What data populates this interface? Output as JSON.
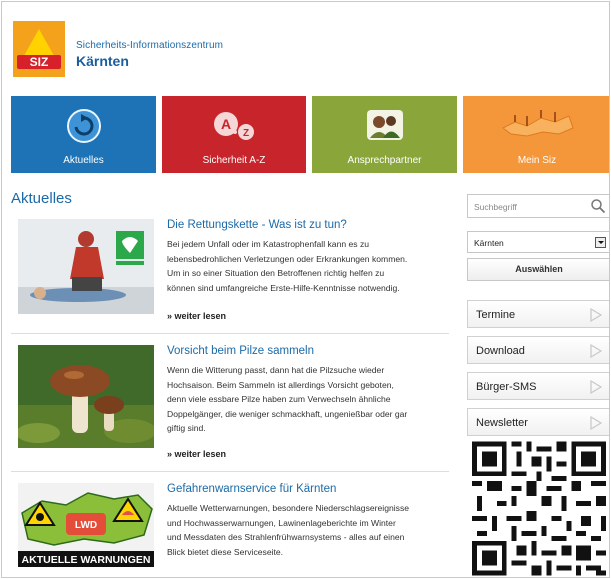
{
  "header": {
    "logo_text": "SIZ",
    "line1": "Sicherheits-Informationszentrum",
    "line2": "Kärnten"
  },
  "tiles": [
    {
      "label": "Aktuelles",
      "color": "#1d73b5",
      "icon": "refresh-arrow-icon"
    },
    {
      "label": "Sicherheit A-Z",
      "color": "#c8242b",
      "icon": "a-to-z-icon"
    },
    {
      "label": "Ansprechpartner",
      "color": "#8aa63a",
      "icon": "people-icon"
    },
    {
      "label": "Mein Siz",
      "color": "#f4973a",
      "icon": "map-icon"
    }
  ],
  "section_title": "Aktuelles",
  "articles": [
    {
      "title": "Die Rettungskette - Was ist zu tun?",
      "lines": [
        "Bei jedem Unfall oder im Katastrophenfall kann es zu",
        "lebensbedrohlichen Verletzungen oder Erkrankungen kommen.",
        "Um in so einer Situation den Betroffenen richtig helfen zu",
        "können sind umfangreiche Erste-Hilfe-Kenntnisse notwendig."
      ],
      "more": "» weiter lesen"
    },
    {
      "title": "Vorsicht beim Pilze sammeln",
      "lines": [
        "Wenn die Witterung passt, dann hat die Pilzsuche wieder",
        "Hochsaison. Beim Sammeln ist allerdings Vorsicht geboten,",
        "denn viele essbare Pilze haben zum Verwechseln ähnliche",
        "Doppelgänger, die weniger schmackhaft, ungenießbar oder gar",
        "giftig sind."
      ],
      "more": "» weiter lesen"
    },
    {
      "title": "Gefahrenwarnservice für Kärnten",
      "lines": [
        "Aktuelle Wetterwarnungen, besondere Niederschlagsereignisse",
        "und Hochwasserwarnungen, Lawinenlageberichte im Winter",
        "und Messdaten des Strahlenfrühwarnsystems - alles auf einen",
        "Blick bietet diese Serviceseite."
      ],
      "image_caption": "AKTUELLE WARNUNGEN",
      "image_badge": "LWD"
    }
  ],
  "sidebar": {
    "search_placeholder": "Suchbegriff",
    "region_value": "Kärnten",
    "select_button": "Auswählen",
    "links": [
      "Termine",
      "Download",
      "Bürger-SMS",
      "Newsletter"
    ]
  },
  "colors": {
    "brand_blue": "#1b6aa8",
    "logo_orange": "#f4a21c",
    "logo_red": "#d8202a"
  }
}
